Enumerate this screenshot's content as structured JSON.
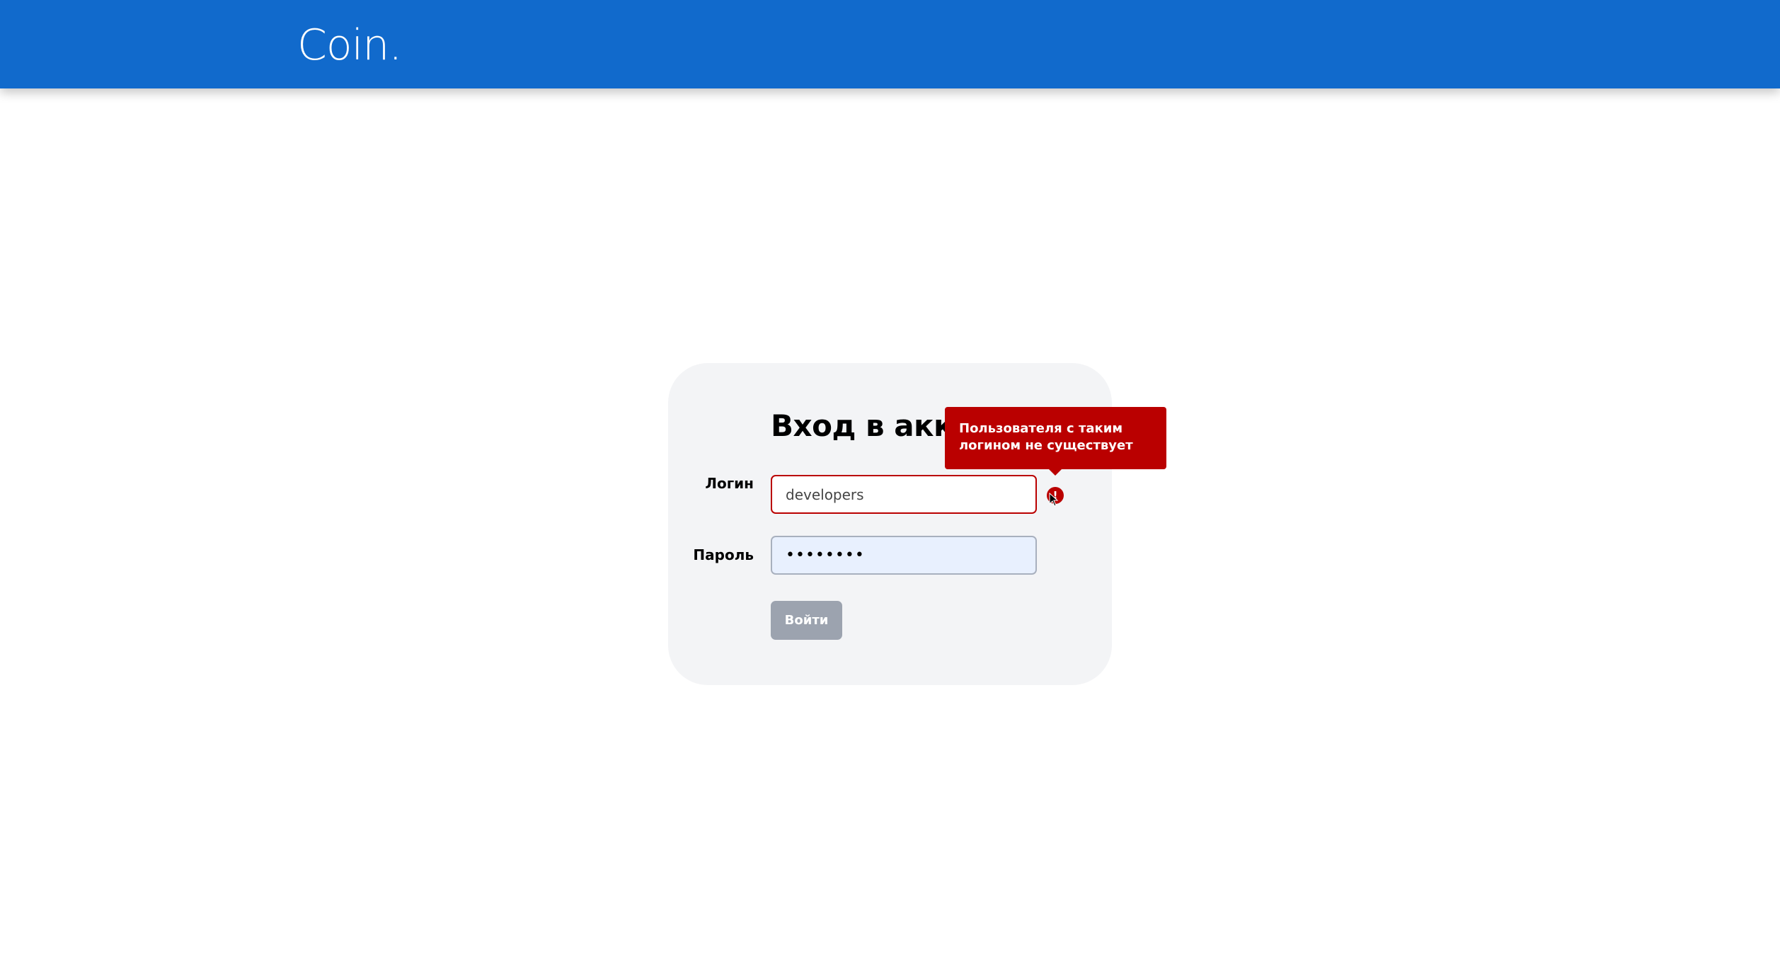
{
  "header": {
    "logo": "Coin.",
    "background_color": "#116ACC"
  },
  "login_form": {
    "title": "Вход в аккаунт",
    "login": {
      "label": "Логин",
      "value": "developers",
      "state": "error"
    },
    "password": {
      "label": "Пароль",
      "value": "••••••••"
    },
    "submit_label": "Войти",
    "error": {
      "icon": "error-icon",
      "icon_glyph": "!",
      "message": "Пользователя с таким логином не существует",
      "color": "#BA0000"
    }
  }
}
